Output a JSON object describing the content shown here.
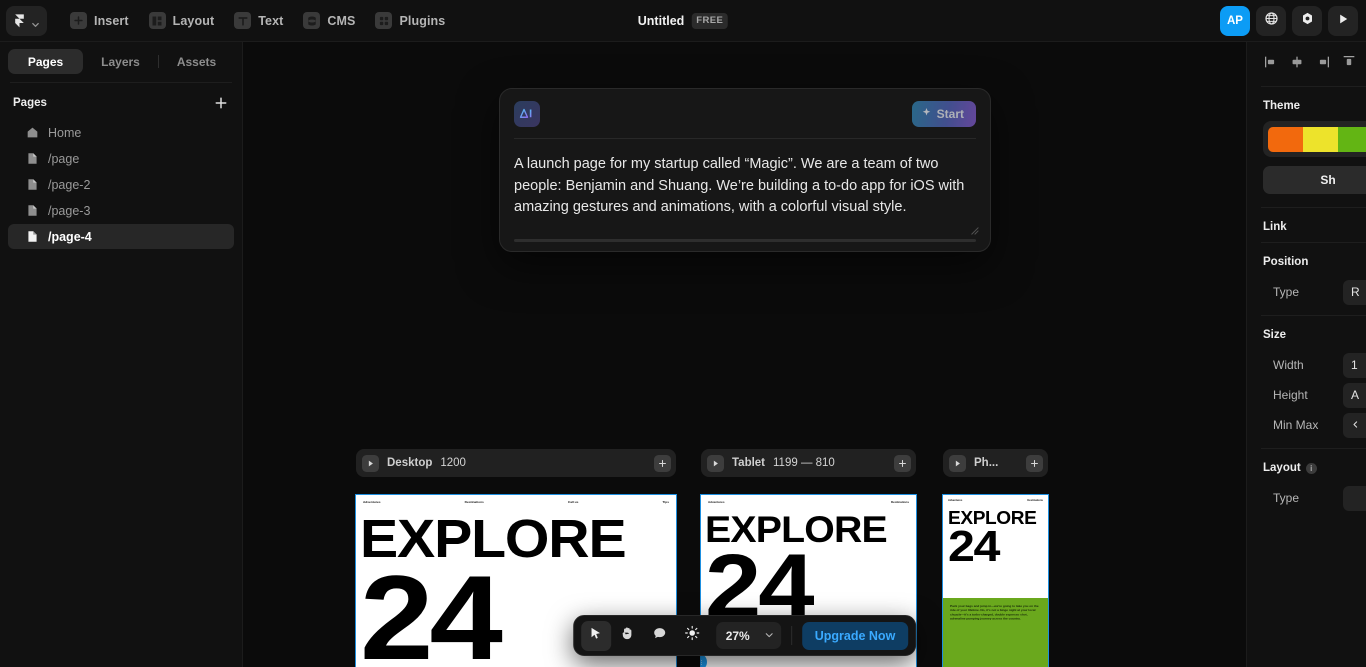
{
  "topbar": {
    "logo_name": "framer-logo",
    "menus": [
      {
        "label": "Insert",
        "icon": "plus-square-icon"
      },
      {
        "label": "Layout",
        "icon": "layout-grid-icon"
      },
      {
        "label": "Text",
        "icon": "text-t-icon"
      },
      {
        "label": "CMS",
        "icon": "database-icon"
      },
      {
        "label": "Plugins",
        "icon": "plugins-icon"
      }
    ],
    "document_title": "Untitled",
    "plan_badge": "FREE",
    "avatar_initials": "AP",
    "right_icons": [
      "globe-icon",
      "publish-icon",
      "preview-play-icon"
    ]
  },
  "sidebar": {
    "tabs": [
      {
        "label": "Pages",
        "active": true
      },
      {
        "label": "Layers",
        "active": false
      },
      {
        "label": "Assets",
        "active": false
      }
    ],
    "section_label": "Pages",
    "add_button": "add-page-button",
    "pages": [
      {
        "label": "Home",
        "icon": "home-icon",
        "selected": false
      },
      {
        "label": "/page",
        "icon": "page-icon",
        "selected": false
      },
      {
        "label": "/page-2",
        "icon": "page-icon",
        "selected": false
      },
      {
        "label": "/page-3",
        "icon": "page-icon",
        "selected": false
      },
      {
        "label": "/page-4",
        "icon": "page-icon",
        "selected": true
      }
    ]
  },
  "ai_card": {
    "logo_label": "AI",
    "start_label": "Start",
    "prompt_text": "A launch page for my startup called “Magic”. We are a team of two people: Benjamin and Shuang. We’re building a to-do app for iOS with amazing gestures and animations, with a colorful visual style."
  },
  "canvas": {
    "frames": [
      {
        "name": "Desktop",
        "size": "1200"
      },
      {
        "name": "Tablet",
        "size": "1199 — 810"
      },
      {
        "name": "Ph...",
        "size": ""
      }
    ],
    "artboards": {
      "desktop": {
        "nav": [
          "Adventures",
          "Destinations",
          "Call us",
          "Tips"
        ],
        "headline": "EXPLORE",
        "number": "24"
      },
      "tablet": {
        "nav": [
          "Adventures",
          "Destinations"
        ],
        "headline": "EXPLORE",
        "number": "24"
      },
      "phone": {
        "nav": [
          "Adventures",
          "Destinations"
        ],
        "headline": "EXPLORE",
        "number": "24",
        "body": "Pack your bags and jump in—we're going to take you on the ride of your lifetime. No, it's not a binge night at your local chuzzle—it's a turbo-charged, double espresso shot, adrenaline pumping journey across the country."
      }
    }
  },
  "bottom_toolbar": {
    "tools": [
      {
        "name": "cursor-tool",
        "active": true
      },
      {
        "name": "hand-tool",
        "active": false
      },
      {
        "name": "comment-tool",
        "active": false
      },
      {
        "name": "theme-brightness-tool",
        "active": false
      }
    ],
    "zoom_level": "27%",
    "upgrade_label": "Upgrade Now"
  },
  "right_panel": {
    "align_icons": [
      "align-left-icon",
      "align-center-horizontal-icon",
      "align-right-icon",
      "align-top-icon"
    ],
    "theme": {
      "title": "Theme",
      "colors": [
        "#F2690D",
        "#EDE32B",
        "#63B514"
      ],
      "button_label": "Sh"
    },
    "link": {
      "title": "Link"
    },
    "position": {
      "title": "Position",
      "type_label": "Type",
      "type_value": "R"
    },
    "size": {
      "title": "Size",
      "rows": [
        {
          "label": "Width",
          "value": "1"
        },
        {
          "label": "Height",
          "value": "A"
        },
        {
          "label": "Min Max",
          "value": ""
        }
      ]
    },
    "layout": {
      "title": "Layout",
      "type_label": "Type",
      "type_value": ""
    }
  }
}
